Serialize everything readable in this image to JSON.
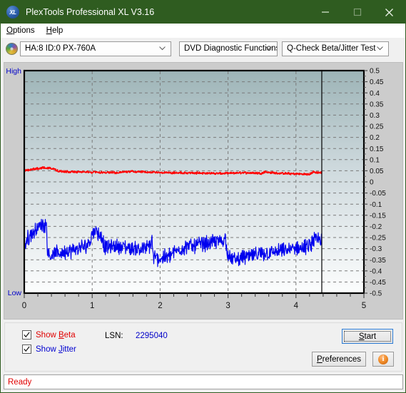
{
  "window": {
    "title": "PlexTools Professional XL V3.16",
    "app_icon": "XL",
    "accent_color": "#2f5c20",
    "minimize_label": "minimize",
    "maximize_label": "maximize",
    "close_label": "close"
  },
  "menubar": {
    "items": [
      {
        "label": "Options",
        "accel": "O"
      },
      {
        "label": "Help",
        "accel": "H"
      }
    ]
  },
  "toolbar": {
    "drive": {
      "value": "HA:8 ID:0  PX-760A",
      "icon": "disc-icon"
    },
    "function": {
      "value": "DVD Diagnostic Functions"
    },
    "test": {
      "value": "Q-Check Beta/Jitter Test"
    }
  },
  "controls": {
    "show_beta": {
      "label": "Show Beta",
      "checked": true,
      "color": "#e00000"
    },
    "show_jitter": {
      "label": "Show Jitter",
      "checked": true,
      "color": "#0000d0"
    },
    "lsn_label": "LSN:",
    "lsn_value": "2295040",
    "start_label": "Start",
    "preferences_label": "Preferences",
    "info_label": "i"
  },
  "statusbar": {
    "text": "Ready"
  },
  "chart_data": {
    "type": "line",
    "title": "",
    "xlabel": "",
    "ylabel": "",
    "left_axis_top_label": "High",
    "left_axis_bottom_label": "Low",
    "xlim": [
      0,
      5
    ],
    "ylim": [
      -0.5,
      0.5
    ],
    "x_ticks": [
      0,
      1,
      2,
      3,
      4,
      5
    ],
    "x_minor_tick_step": 0.2,
    "y_ticks": [
      0.5,
      0.45,
      0.4,
      0.35,
      0.3,
      0.25,
      0.2,
      0.15,
      0.1,
      0.05,
      0,
      -0.05,
      -0.1,
      -0.15,
      -0.2,
      -0.25,
      -0.3,
      -0.35,
      -0.4,
      -0.45,
      -0.5
    ],
    "grid": true,
    "grid_style": "dashed",
    "cursor_x": 4.38,
    "plot_bg_gradient": [
      "#9db4b7",
      "#fbfcfc"
    ],
    "series": [
      {
        "name": "Beta",
        "color": "#ff0000",
        "x": [
          0.0,
          0.05,
          0.1,
          0.15,
          0.2,
          0.25,
          0.3,
          0.35,
          0.4,
          0.45,
          0.5,
          0.6,
          0.7,
          0.8,
          0.9,
          1.0,
          1.1,
          1.2,
          1.3,
          1.4,
          1.5,
          1.6,
          1.7,
          1.8,
          1.85,
          1.9,
          2.0,
          2.1,
          2.2,
          2.3,
          2.4,
          2.5,
          2.6,
          2.7,
          2.8,
          2.9,
          3.0,
          3.1,
          3.2,
          3.3,
          3.4,
          3.5,
          3.55,
          3.6,
          3.7,
          3.8,
          3.9,
          4.0,
          4.1,
          4.2,
          4.25,
          4.3,
          4.38
        ],
        "values": [
          0.052,
          0.054,
          0.056,
          0.058,
          0.06,
          0.062,
          0.063,
          0.062,
          0.06,
          0.055,
          0.048,
          0.046,
          0.045,
          0.044,
          0.044,
          0.043,
          0.043,
          0.042,
          0.042,
          0.042,
          0.045,
          0.046,
          0.045,
          0.044,
          0.043,
          0.043,
          0.042,
          0.042,
          0.041,
          0.041,
          0.04,
          0.04,
          0.04,
          0.039,
          0.038,
          0.038,
          0.038,
          0.04,
          0.041,
          0.041,
          0.04,
          0.039,
          0.046,
          0.042,
          0.04,
          0.038,
          0.037,
          0.036,
          0.035,
          0.034,
          0.044,
          0.042,
          0.041
        ],
        "noise": 0.004
      },
      {
        "name": "Jitter",
        "color": "#0000ee",
        "x": [
          0.0,
          0.03,
          0.06,
          0.1,
          0.14,
          0.18,
          0.22,
          0.26,
          0.3,
          0.33,
          0.34,
          0.36,
          0.4,
          0.5,
          0.6,
          0.7,
          0.8,
          0.9,
          0.97,
          1.0,
          1.05,
          1.1,
          1.15,
          1.18,
          1.2,
          1.3,
          1.4,
          1.5,
          1.6,
          1.7,
          1.8,
          1.85,
          1.88,
          1.9,
          2.0,
          2.1,
          2.2,
          2.3,
          2.4,
          2.5,
          2.6,
          2.7,
          2.8,
          2.9,
          2.96,
          3.0,
          3.05,
          3.1,
          3.2,
          3.3,
          3.4,
          3.5,
          3.6,
          3.7,
          3.8,
          3.9,
          4.0,
          4.1,
          4.2,
          4.25,
          4.28,
          4.32,
          4.38
        ],
        "values": [
          -0.29,
          -0.265,
          -0.25,
          -0.235,
          -0.225,
          -0.21,
          -0.2,
          -0.195,
          -0.19,
          -0.19,
          -0.31,
          -0.325,
          -0.33,
          -0.32,
          -0.315,
          -0.31,
          -0.3,
          -0.29,
          -0.265,
          -0.23,
          -0.215,
          -0.235,
          -0.255,
          -0.29,
          -0.295,
          -0.29,
          -0.29,
          -0.295,
          -0.3,
          -0.3,
          -0.3,
          -0.285,
          -0.265,
          -0.34,
          -0.345,
          -0.335,
          -0.32,
          -0.3,
          -0.29,
          -0.285,
          -0.28,
          -0.275,
          -0.27,
          -0.265,
          -0.255,
          -0.33,
          -0.345,
          -0.35,
          -0.34,
          -0.335,
          -0.33,
          -0.325,
          -0.32,
          -0.315,
          -0.31,
          -0.305,
          -0.3,
          -0.295,
          -0.29,
          -0.265,
          -0.262,
          -0.262,
          -0.262
        ],
        "noise": 0.028
      }
    ]
  }
}
